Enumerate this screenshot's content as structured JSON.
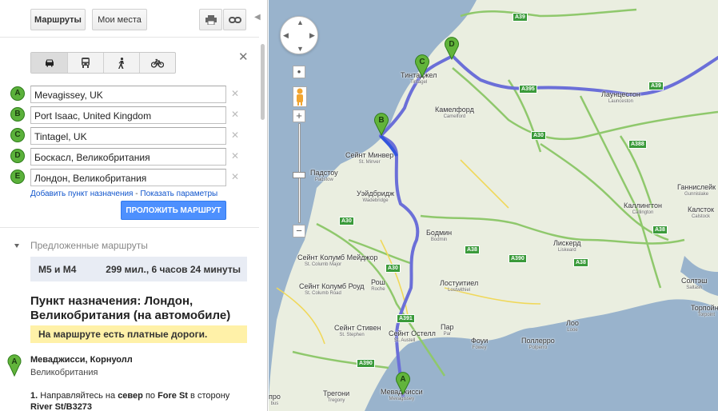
{
  "toolbar": {
    "routes_tab": "Маршруты",
    "places_tab": "Мои места",
    "print_icon": "print-icon",
    "link_icon": "link-icon"
  },
  "modes": [
    "car-icon",
    "transit-icon",
    "walk-icon",
    "bike-icon"
  ],
  "waypoints": [
    {
      "letter": "A",
      "value": "Mevagissey, UK"
    },
    {
      "letter": "B",
      "value": "Port Isaac, United Kingdom"
    },
    {
      "letter": "C",
      "value": "Tintagel, UK"
    },
    {
      "letter": "D",
      "value": "Боскасл, Великобритания"
    },
    {
      "letter": "E",
      "value": "Лондон, Великобритания"
    }
  ],
  "links": {
    "add_destination": "Добавить пункт назначения",
    "separator": " - ",
    "show_options": "Показать параметры"
  },
  "route_button": "ПРОЛОЖИТЬ МАРШРУТ",
  "suggested": {
    "heading": "Предложенные маршруты",
    "route_name": "M5 и M4",
    "route_info": "299 мил., 6 часов 24 минуты"
  },
  "destination": {
    "title": "Пункт назначения: Лондон, Великобритания (на автомобиле)",
    "toll_notice": "На маршруте есть платные дороги."
  },
  "directions": {
    "start_letter": "A",
    "start_name": "Меваджисси, Корнуолл",
    "start_country": "Великобритания",
    "step1_num": "1.",
    "step1_a": " Направляйтесь на ",
    "step1_b": "север",
    "step1_c": " по ",
    "step1_d": "Fore St",
    "step1_e": " в сторону ",
    "step1_f": "River St/B3273"
  },
  "map": {
    "colors": {
      "sea": "#99b3cc",
      "land": "#eaeee0",
      "route": "#6b6fd8",
      "road_green": "#7fbf5f",
      "road_yellow": "#f3e27a",
      "pin": "#62b43b"
    },
    "pins": [
      "B",
      "C",
      "D",
      "A"
    ],
    "places": [
      {
        "name": "Тинтаджел",
        "sub": "Tintagel"
      },
      {
        "name": "Камелфорд",
        "sub": "Camelford"
      },
      {
        "name": "Лаунцестон",
        "sub": "Launceston"
      },
      {
        "name": "Сейнт Минвер",
        "sub": "St. Minver"
      },
      {
        "name": "Падстоу",
        "sub": "Padstow"
      },
      {
        "name": "Уэйдбридж",
        "sub": "Wadebridge"
      },
      {
        "name": "Бодмин",
        "sub": "Bodmin"
      },
      {
        "name": "Каллингтон",
        "sub": "Callington"
      },
      {
        "name": "Ганнислейк",
        "sub": "Gunnislake"
      },
      {
        "name": "Калсток",
        "sub": "Calstock"
      },
      {
        "name": "Лискерд",
        "sub": "Liskeard"
      },
      {
        "name": "Сейнт Колумб Мейджор",
        "sub": "St. Columb Major"
      },
      {
        "name": "Рош",
        "sub": "Roche"
      },
      {
        "name": "Лостуитиел",
        "sub": "Lostwithiel"
      },
      {
        "name": "Сейнт Колумб Роуд",
        "sub": "St. Columb Road"
      },
      {
        "name": "Солтэш",
        "sub": "Saltash"
      },
      {
        "name": "Торпойнт",
        "sub": "Torpoint"
      },
      {
        "name": "Сейнт Стивен",
        "sub": "St. Stephen"
      },
      {
        "name": "Сейнт Остелл",
        "sub": "St. Austell"
      },
      {
        "name": "Пар",
        "sub": "Par"
      },
      {
        "name": "Фоуи",
        "sub": "Fowey"
      },
      {
        "name": "Поллерро",
        "sub": "Polperro"
      },
      {
        "name": "Лоо",
        "sub": "Looe"
      },
      {
        "name": "Трегони",
        "sub": "Tregony"
      },
      {
        "name": "Меваджисси",
        "sub": "Mevagissey"
      },
      {
        "name": "про",
        "sub": "bus"
      }
    ],
    "roads": [
      "A39",
      "A395",
      "A30",
      "A388",
      "A39",
      "A38",
      "A38",
      "A390",
      "A38",
      "A30",
      "A391",
      "A390",
      "A30"
    ]
  }
}
